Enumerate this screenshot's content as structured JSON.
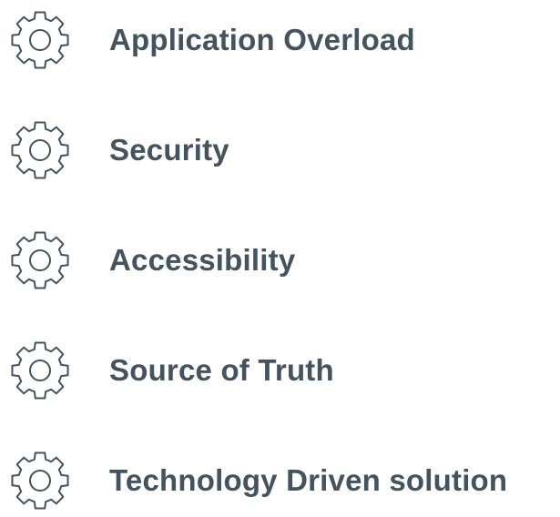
{
  "items": [
    {
      "label": "Application Overload",
      "icon": "gear-icon"
    },
    {
      "label": "Security",
      "icon": "gear-icon"
    },
    {
      "label": "Accessibility",
      "icon": "gear-icon"
    },
    {
      "label": "Source of Truth",
      "icon": "gear-icon"
    },
    {
      "label": "Technology Driven solution",
      "icon": "gear-icon"
    }
  ],
  "colors": {
    "text": "#44535d",
    "icon_stroke": "#44535d",
    "background": "#ffffff"
  }
}
